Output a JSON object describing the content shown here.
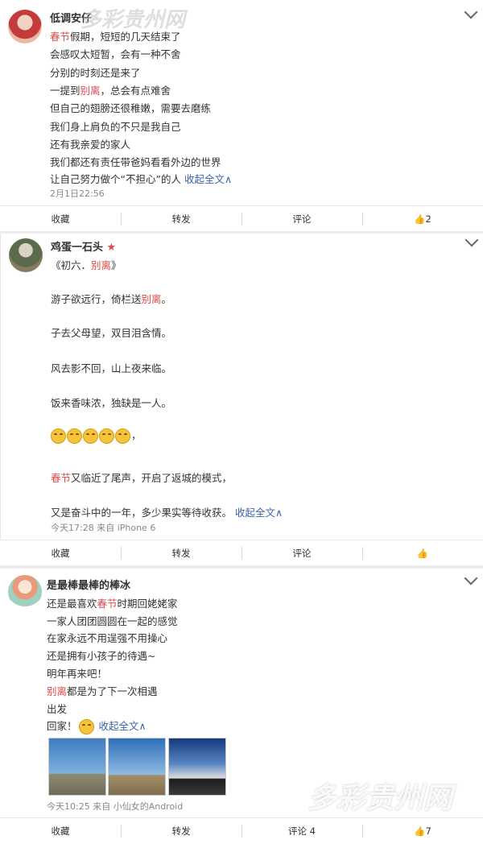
{
  "watermark_text": "多彩贵州网",
  "posts": [
    {
      "author": "低调安仔",
      "lines": [
        [
          "",
          "春节",
          "假期，短短的几天结束了"
        ],
        [
          "会感叹太短暂，会有一种不舍",
          "",
          ""
        ],
        [
          "分别的时刻还是来了",
          "",
          ""
        ],
        [
          "一提到",
          "别离",
          "，总会有点难舍"
        ],
        [
          "但自己的翅膀还很稚嫩，需要去磨练",
          "",
          ""
        ],
        [
          "我们身上肩负的不只是我自己",
          "",
          ""
        ],
        [
          "还有我亲爱的家人",
          "",
          ""
        ],
        [
          "我们都还有责任带爸妈看看外边的世界",
          "",
          ""
        ],
        [
          "让自己努力做个“不担心”的人",
          "",
          ""
        ]
      ],
      "collapse": "收起全文∧",
      "time": "2月1日22:56",
      "actions": {
        "fav": "收藏",
        "repost": "转发",
        "comment": "评论",
        "like": "2"
      }
    },
    {
      "author": "鸡蛋一石头",
      "subtitle_pre": "《初六．",
      "subtitle_hl": "别离",
      "subtitle_post": "》",
      "lines": [
        [
          "游子欲远行，倚栏送",
          "别离",
          "。"
        ],
        [
          "子去父母望，双目泪含情。",
          "",
          ""
        ],
        [
          "风去影不回，山上夜来临。",
          "",
          ""
        ],
        [
          "饭来香味浓，独缺是一人。",
          "",
          ""
        ],
        [
          "",
          "春节",
          "又临近了尾声，开启了返城的模式，"
        ],
        [
          "又是奋斗中的一年，多少果实等待收获。",
          "",
          ""
        ]
      ],
      "emoji_suffix": "，",
      "collapse": "收起全文∧",
      "time": "今天17:28 来自 iPhone 6",
      "actions": {
        "fav": "收藏",
        "repost": "转发",
        "comment": "评论",
        "like": ""
      }
    },
    {
      "author": "是最棒最棒的棒冰",
      "lines": [
        [
          "还是最喜欢",
          "春节",
          "时期回姥姥家"
        ],
        [
          "一家人团团圆圆在一起的感觉",
          "",
          ""
        ],
        [
          "在家永远不用逞强不用操心",
          "",
          ""
        ],
        [
          "还是拥有小孩子的待遇~",
          "",
          ""
        ],
        [
          "明年再来吧！",
          "",
          ""
        ],
        [
          "",
          "别离",
          "都是为了下一次相遇"
        ],
        [
          "出发",
          "",
          ""
        ],
        [
          "回家！",
          "",
          ""
        ]
      ],
      "collapse": "收起全文∧",
      "time": "今天10:25 来自 小仙女的Android",
      "actions": {
        "fav": "收藏",
        "repost": "转发",
        "comment": "评论 4",
        "like": "7"
      }
    }
  ]
}
